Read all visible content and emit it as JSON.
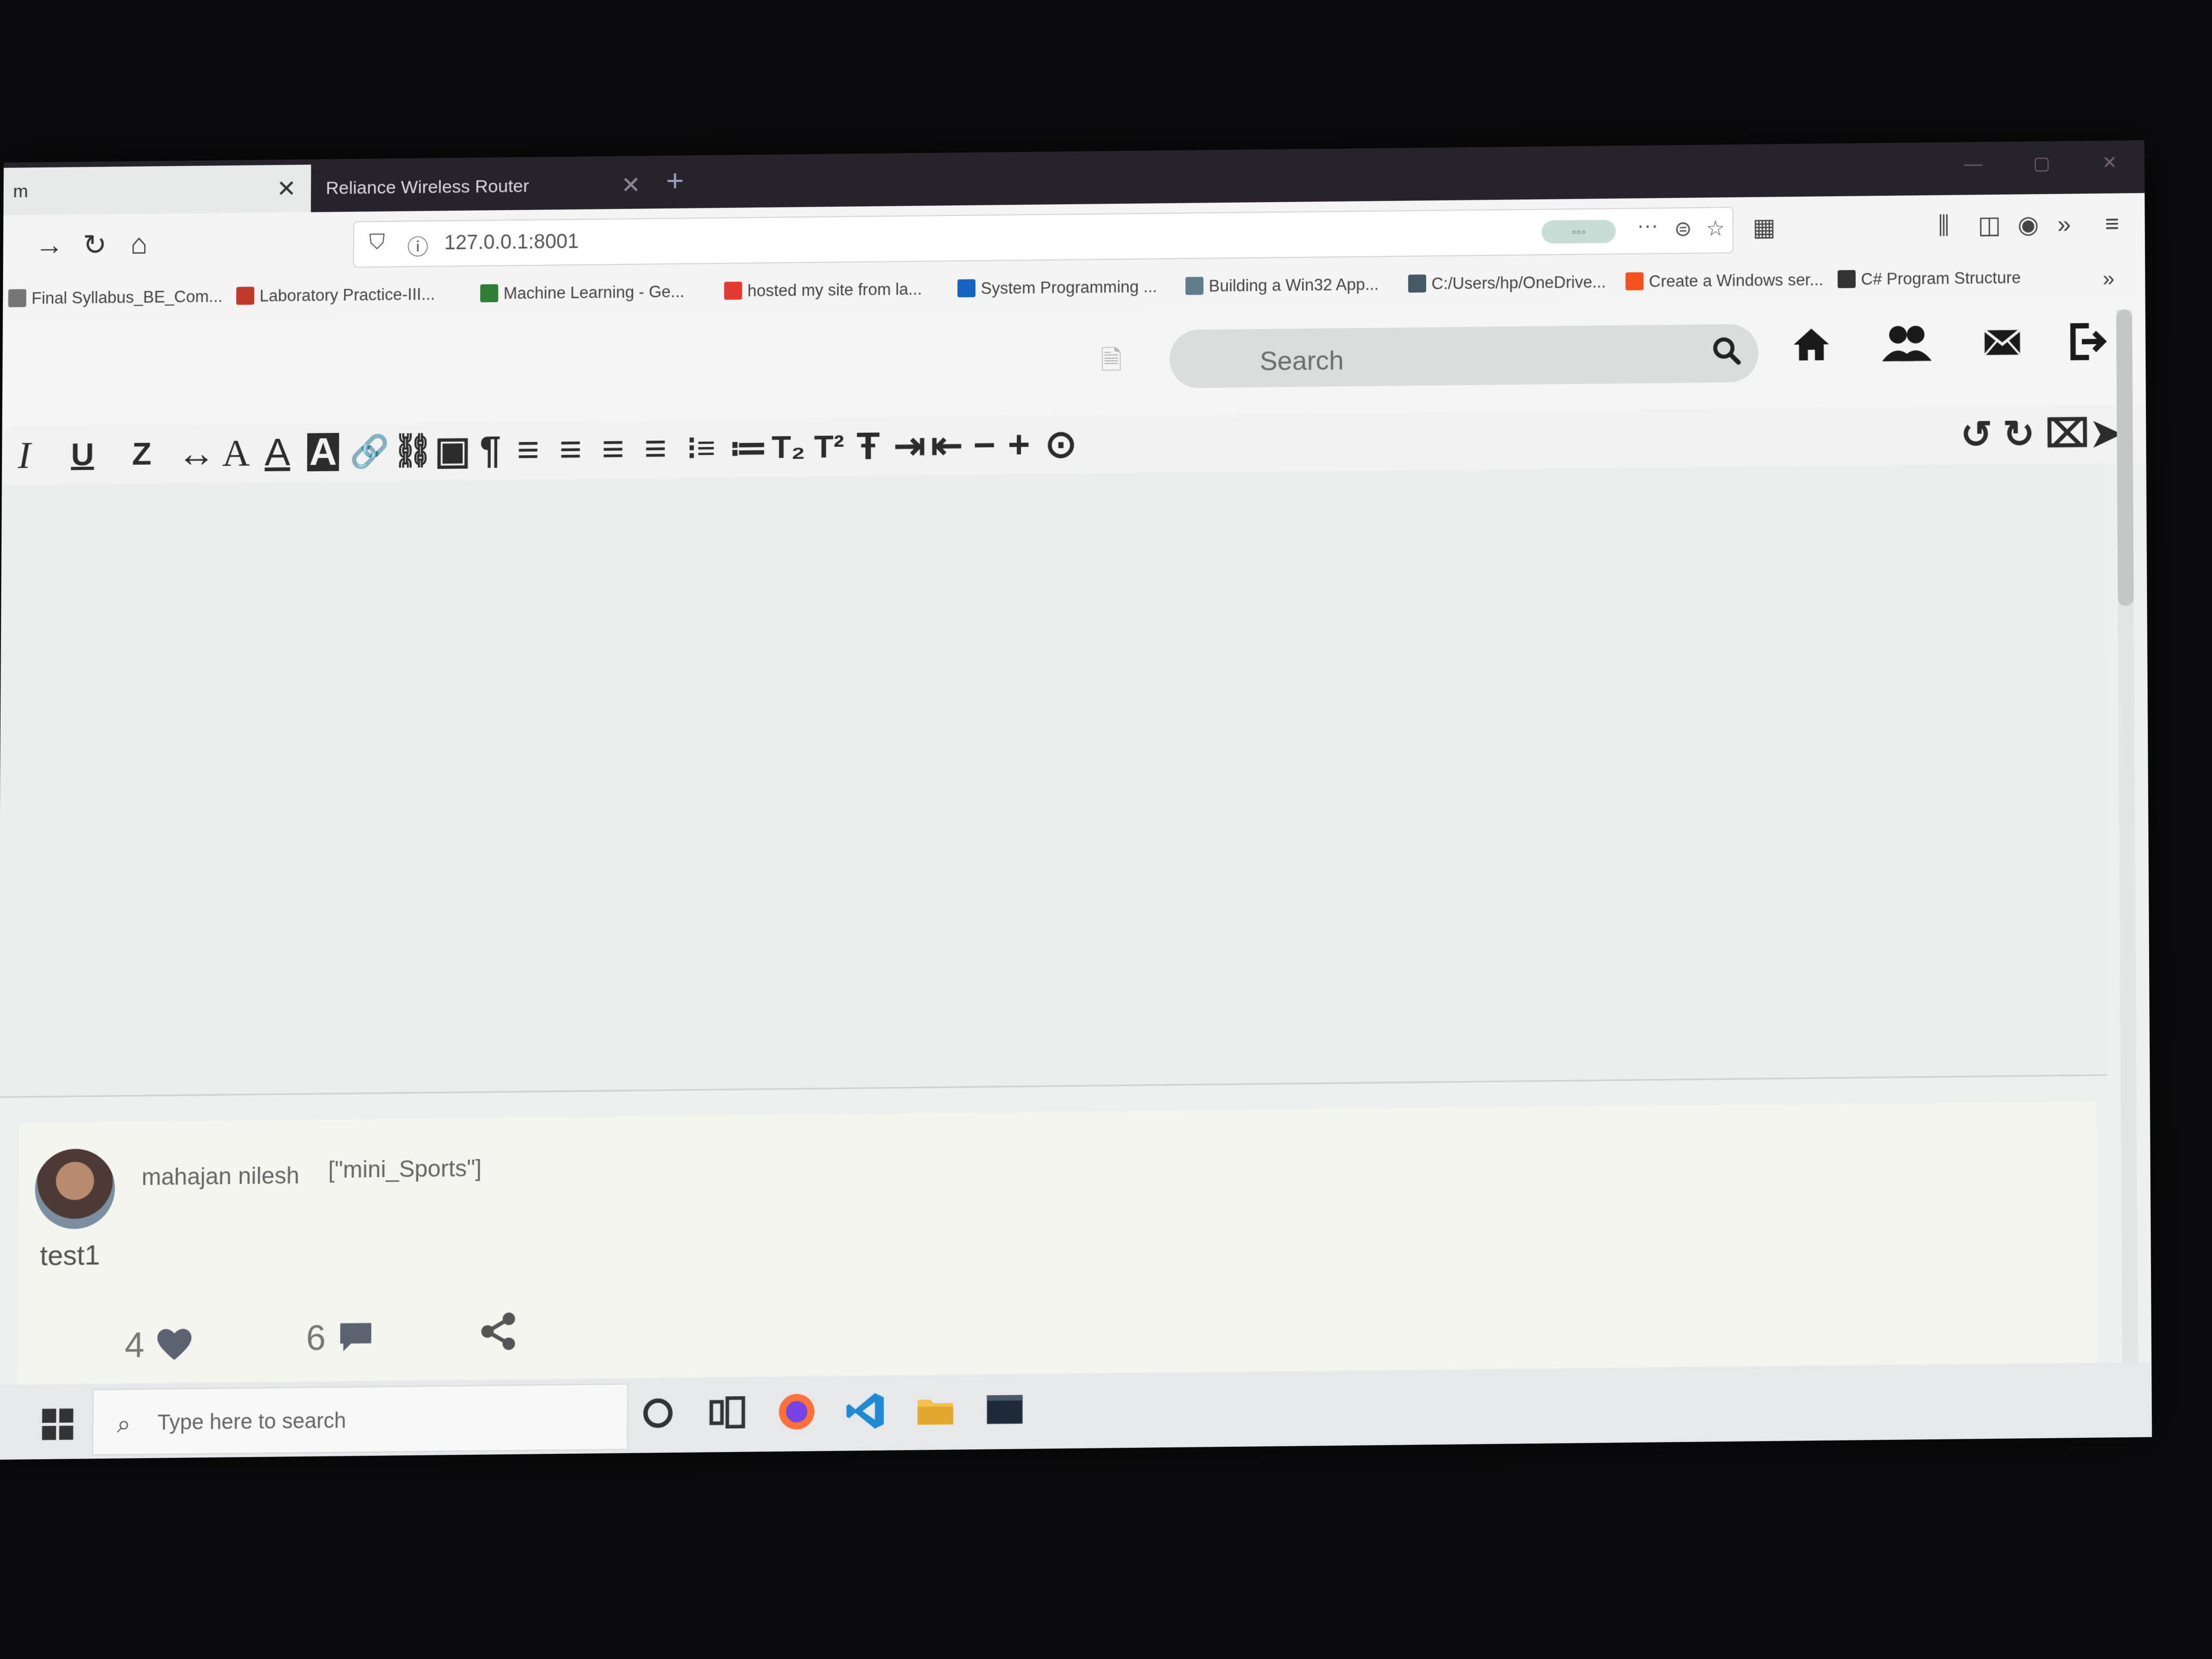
{
  "browser": {
    "tabs": [
      {
        "title": "m",
        "active": true
      },
      {
        "title": "Reliance Wireless Router",
        "active": false
      }
    ],
    "new_tab_symbol": "+",
    "url": "127.0.0.1:8001",
    "bookmarks": [
      {
        "label": "Final Syllabus_BE_Com...",
        "icon_color": "#777777"
      },
      {
        "label": "Laboratory Practice-III...",
        "icon_color": "#c0392b"
      },
      {
        "label": "Machine Learning - Ge...",
        "icon_color": "#2e7d32"
      },
      {
        "label": "hosted my site from la...",
        "icon_color": "#e53935"
      },
      {
        "label": "System Programming ...",
        "icon_color": "#1565c0"
      },
      {
        "label": "Building a Win32 App...",
        "icon_color": "#607d8b"
      },
      {
        "label": "C:/Users/hp/OneDrive...",
        "icon_color": "#455a64"
      },
      {
        "label": "Create a Windows ser...",
        "icon_color": "#f4511e"
      },
      {
        "label": "C# Program Structure",
        "icon_color": "#333333"
      }
    ]
  },
  "app": {
    "search_placeholder": "Search",
    "toolbar_glyphs": [
      "I",
      "U",
      "Z",
      "↔",
      "A",
      "A",
      "A",
      "🔗",
      "⛓",
      "▣",
      "¶",
      "≡",
      "≡",
      "≡",
      "≡",
      "⁝≡",
      "≔",
      "T₂",
      "T²",
      "Ŧ",
      "⇥",
      "⇤",
      "−",
      "+",
      "⊙"
    ],
    "toolbar_right_glyphs": [
      "↺",
      "↻",
      "⌧",
      "➤"
    ]
  },
  "post": {
    "author": "mahajan nilesh",
    "tags": "[\"mini_Sports\"]",
    "body": "test1",
    "likes": "4",
    "comments": "6"
  },
  "taskbar": {
    "search_placeholder": "Type here to search"
  },
  "colors": {
    "tab_bar": "#28232a",
    "page_bg": "#eef0ef",
    "accent": "#2c2c2c"
  }
}
